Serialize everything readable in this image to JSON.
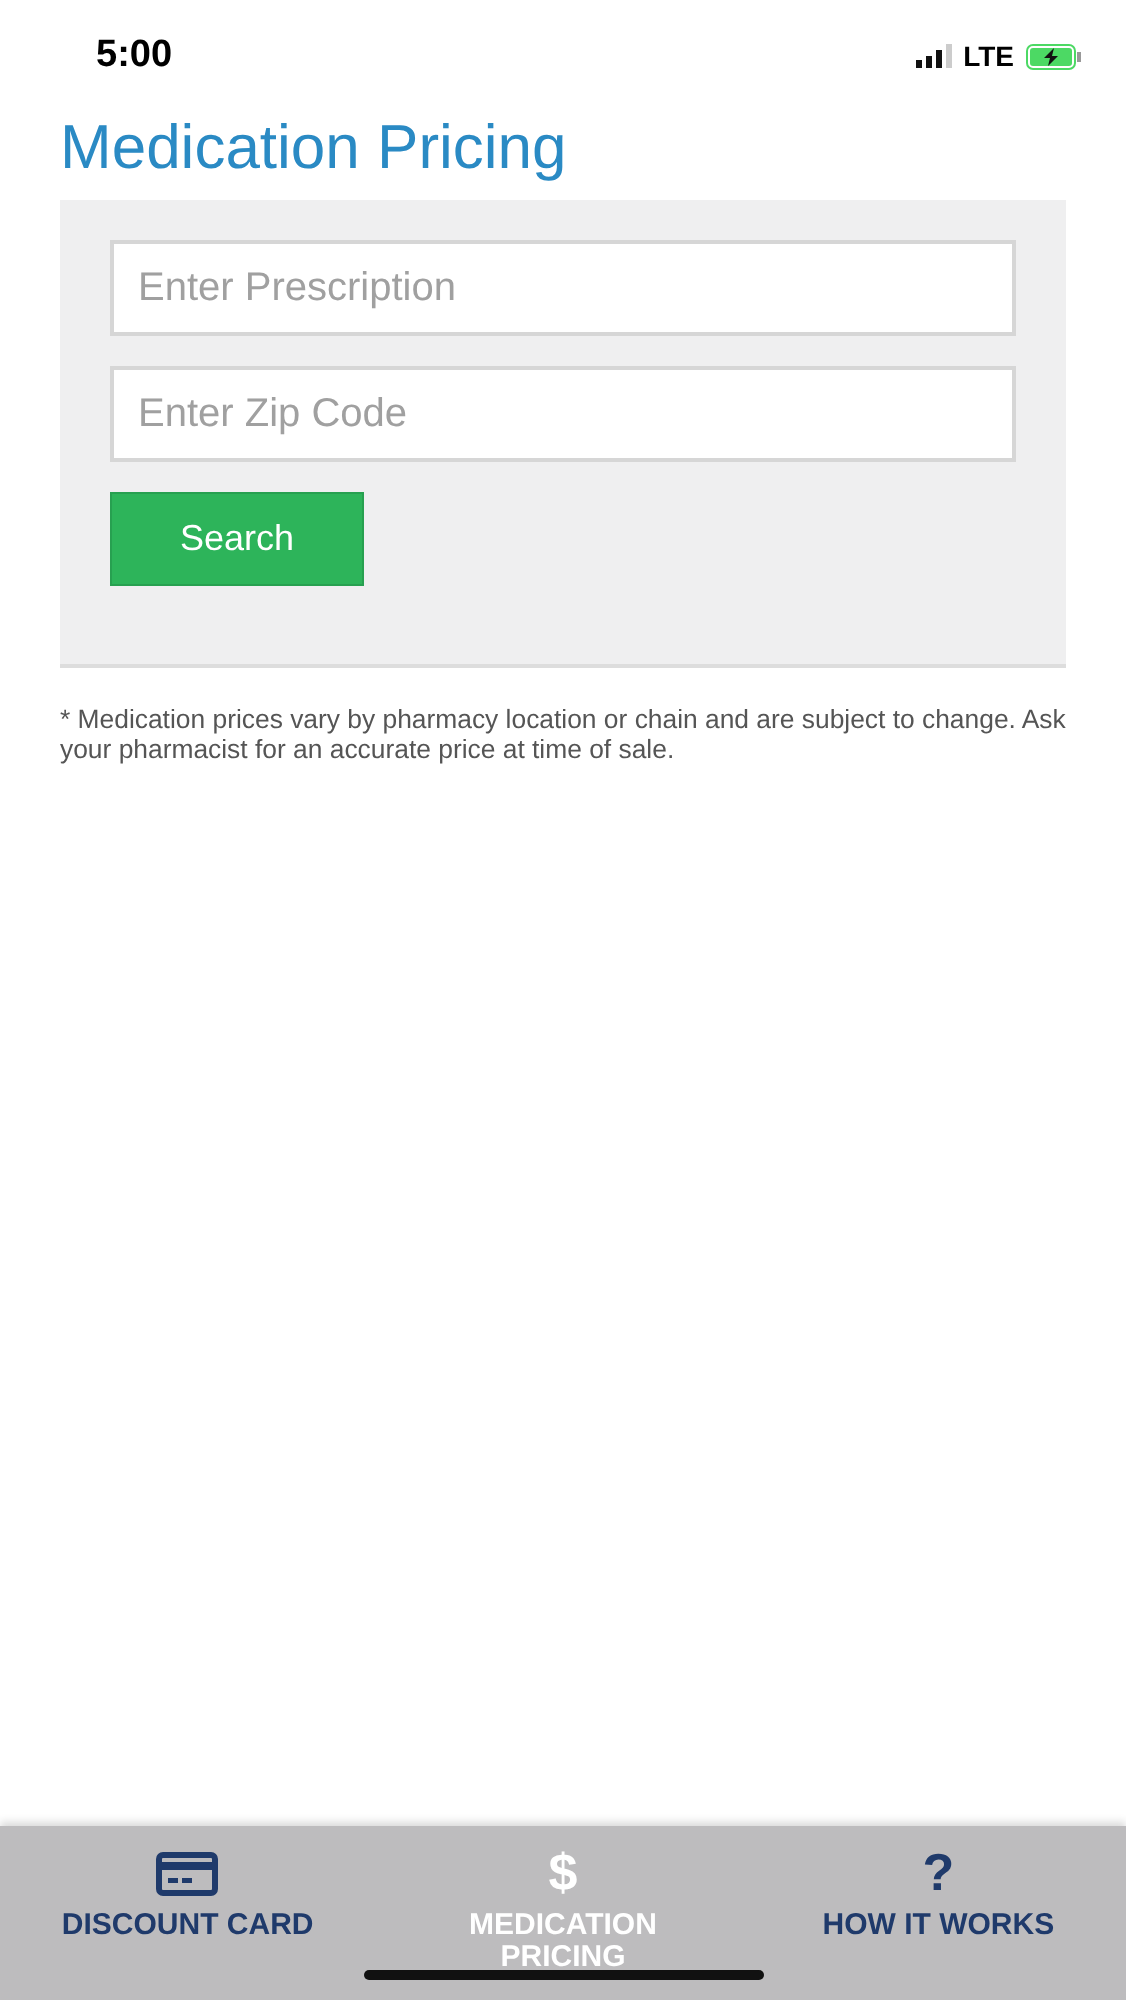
{
  "status_bar": {
    "time": "5:00",
    "network": "LTE"
  },
  "title": "Medication Pricing",
  "form": {
    "prescription": {
      "placeholder": "Enter Prescription"
    },
    "zip": {
      "placeholder": "Enter Zip Code"
    },
    "button": "Search"
  },
  "disclaimer": "* Medication prices vary by pharmacy location or chain and are subject to change. Ask your pharmacist for an accurate price at time of sale.",
  "tabs": [
    {
      "kind": "card",
      "label": "DISCOUNT CARD",
      "selected": false
    },
    {
      "kind": "glyph",
      "glyph": "$",
      "label": "MEDICATION PRICING",
      "selected": true
    },
    {
      "kind": "glyph",
      "glyph": "?",
      "label": "HOW IT WORKS",
      "selected": false
    }
  ]
}
